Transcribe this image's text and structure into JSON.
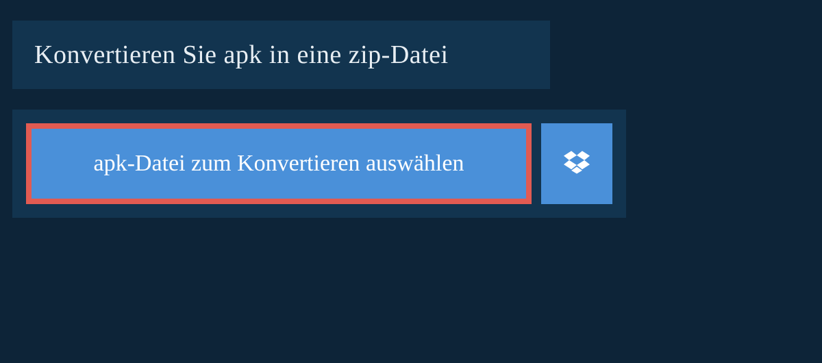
{
  "header": {
    "title": "Konvertieren Sie apk in eine zip-Datei"
  },
  "actions": {
    "select_file_label": "apk-Datei zum Konvertieren auswählen",
    "dropbox_icon": "dropbox-icon"
  },
  "colors": {
    "background": "#0d2438",
    "panel": "#12344f",
    "button_primary": "#4a90d9",
    "button_highlight_border": "#e15b52",
    "text_light": "#e8eef3",
    "text_white": "#ffffff"
  }
}
